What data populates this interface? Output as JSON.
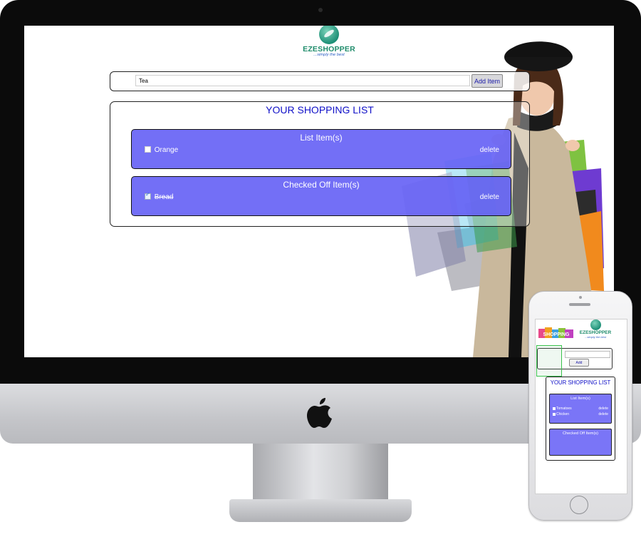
{
  "brand": {
    "name": "EZESHOPPER",
    "tagline": "...simply the best"
  },
  "desktop": {
    "add_item": {
      "input_value": "Tea",
      "button_label": "Add Item"
    },
    "list_title": "YOUR SHOPPING LIST",
    "sections": {
      "list": {
        "title": "List Item(s)",
        "items": [
          {
            "name": "Orange",
            "checked": false,
            "delete_label": "delete"
          }
        ]
      },
      "checked": {
        "title": "Checked Off Item(s)",
        "items": [
          {
            "name": "Bread",
            "checked": true,
            "delete_label": "delete"
          }
        ]
      }
    }
  },
  "mobile": {
    "brand": {
      "name": "EZESHOPPER",
      "tagline": "...simply the best"
    },
    "add_button_label": "Add",
    "list_title": "YOUR SHOPPING LIST",
    "sections": {
      "list": {
        "title": "List Item(s)",
        "items": [
          {
            "name": "Tomatoes",
            "delete_label": "delete"
          },
          {
            "name": "Chicken",
            "delete_label": "delete"
          }
        ]
      },
      "checked": {
        "title": "Checked Off Item(s)",
        "items": []
      }
    }
  },
  "colors": {
    "section_fill": "#6a64f6",
    "title_blue": "#1010c8",
    "brand_green": "#1f8c6b",
    "tagline_blue": "#2d5fc4"
  }
}
